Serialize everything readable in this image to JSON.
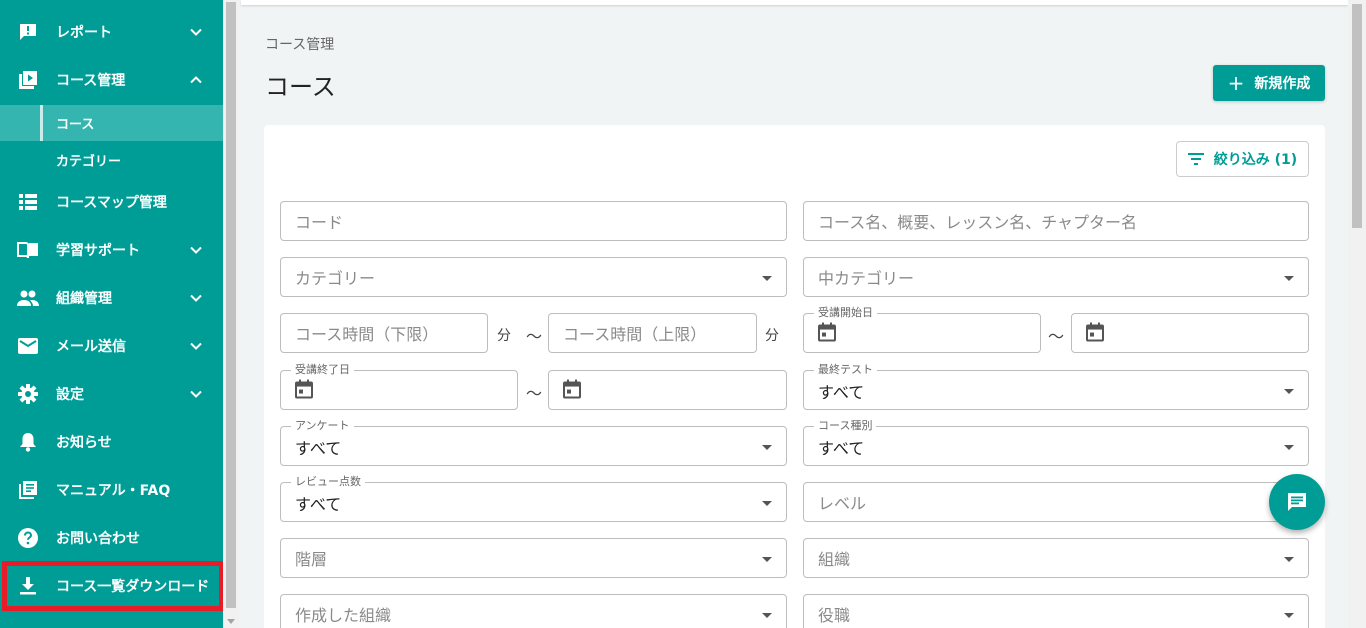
{
  "sidebar": {
    "items": [
      {
        "label": "レポート",
        "icon": "report-icon",
        "chevron": "down"
      },
      {
        "label": "コース管理",
        "icon": "play-box-icon",
        "chevron": "up"
      },
      {
        "label": "コースマップ管理",
        "icon": "list-icon"
      },
      {
        "label": "学習サポート",
        "icon": "book-icon",
        "chevron": "down"
      },
      {
        "label": "組織管理",
        "icon": "people-icon",
        "chevron": "down"
      },
      {
        "label": "メール送信",
        "icon": "mail-icon",
        "chevron": "down"
      },
      {
        "label": "設定",
        "icon": "gear-icon",
        "chevron": "down"
      },
      {
        "label": "お知らせ",
        "icon": "bell-icon"
      },
      {
        "label": "マニュアル・FAQ",
        "icon": "manual-icon"
      },
      {
        "label": "お問い合わせ",
        "icon": "help-icon"
      },
      {
        "label": "コース一覧ダウンロード",
        "icon": "download-icon"
      }
    ],
    "sub_items": [
      {
        "label": "コース",
        "active": true
      },
      {
        "label": "カテゴリー",
        "active": false
      }
    ]
  },
  "header": {
    "breadcrumb": "コース管理",
    "title": "コース",
    "new_button": "新規作成"
  },
  "filter": {
    "button": "絞り込み (1)",
    "code_placeholder": "コード",
    "keyword_placeholder": "コース名、概要、レッスン名、チャプター名",
    "category_placeholder": "カテゴリー",
    "subcategory_placeholder": "中カテゴリー",
    "time_min_placeholder": "コース時間（下限）",
    "time_max_placeholder": "コース時間（上限）",
    "minutes_unit": "分",
    "tilde": "〜",
    "start_date_label": "受講開始日",
    "end_date_label": "受講終了日",
    "final_test_label": "最終テスト",
    "final_test_value": "すべて",
    "survey_label": "アンケート",
    "survey_value": "すべて",
    "course_type_label": "コース種別",
    "course_type_value": "すべて",
    "review_label": "レビュー点数",
    "review_value": "すべて",
    "level_placeholder": "レベル",
    "hierarchy_placeholder": "階層",
    "organization_placeholder": "組織",
    "created_org_placeholder": "作成した組織",
    "position_placeholder": "役職"
  },
  "colors": {
    "brand": "#009d97",
    "highlight": "#e81c27"
  }
}
